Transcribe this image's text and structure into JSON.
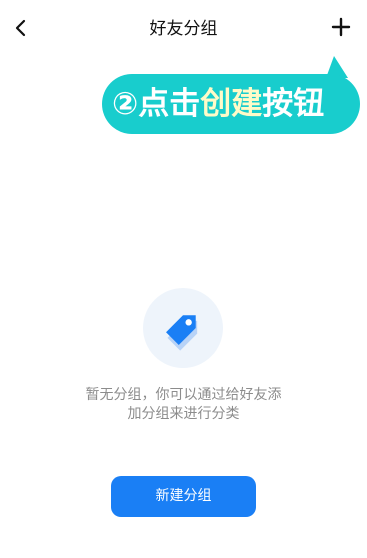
{
  "nav": {
    "title": "好友分组",
    "back_icon": "chevron-left-icon",
    "add_icon": "plus-icon"
  },
  "callout": {
    "prefix": "②点击",
    "highlight": "创建",
    "suffix": "按钮",
    "color": "#18cdcd",
    "highlight_color": "#fffbc8"
  },
  "empty_state": {
    "icon": "tags-icon",
    "line1": "暂无分组，你可以通过给好友添",
    "line2": "加分组来进行分类"
  },
  "new_group_button": {
    "label": "新建分组",
    "color": "#1a7ff5"
  }
}
